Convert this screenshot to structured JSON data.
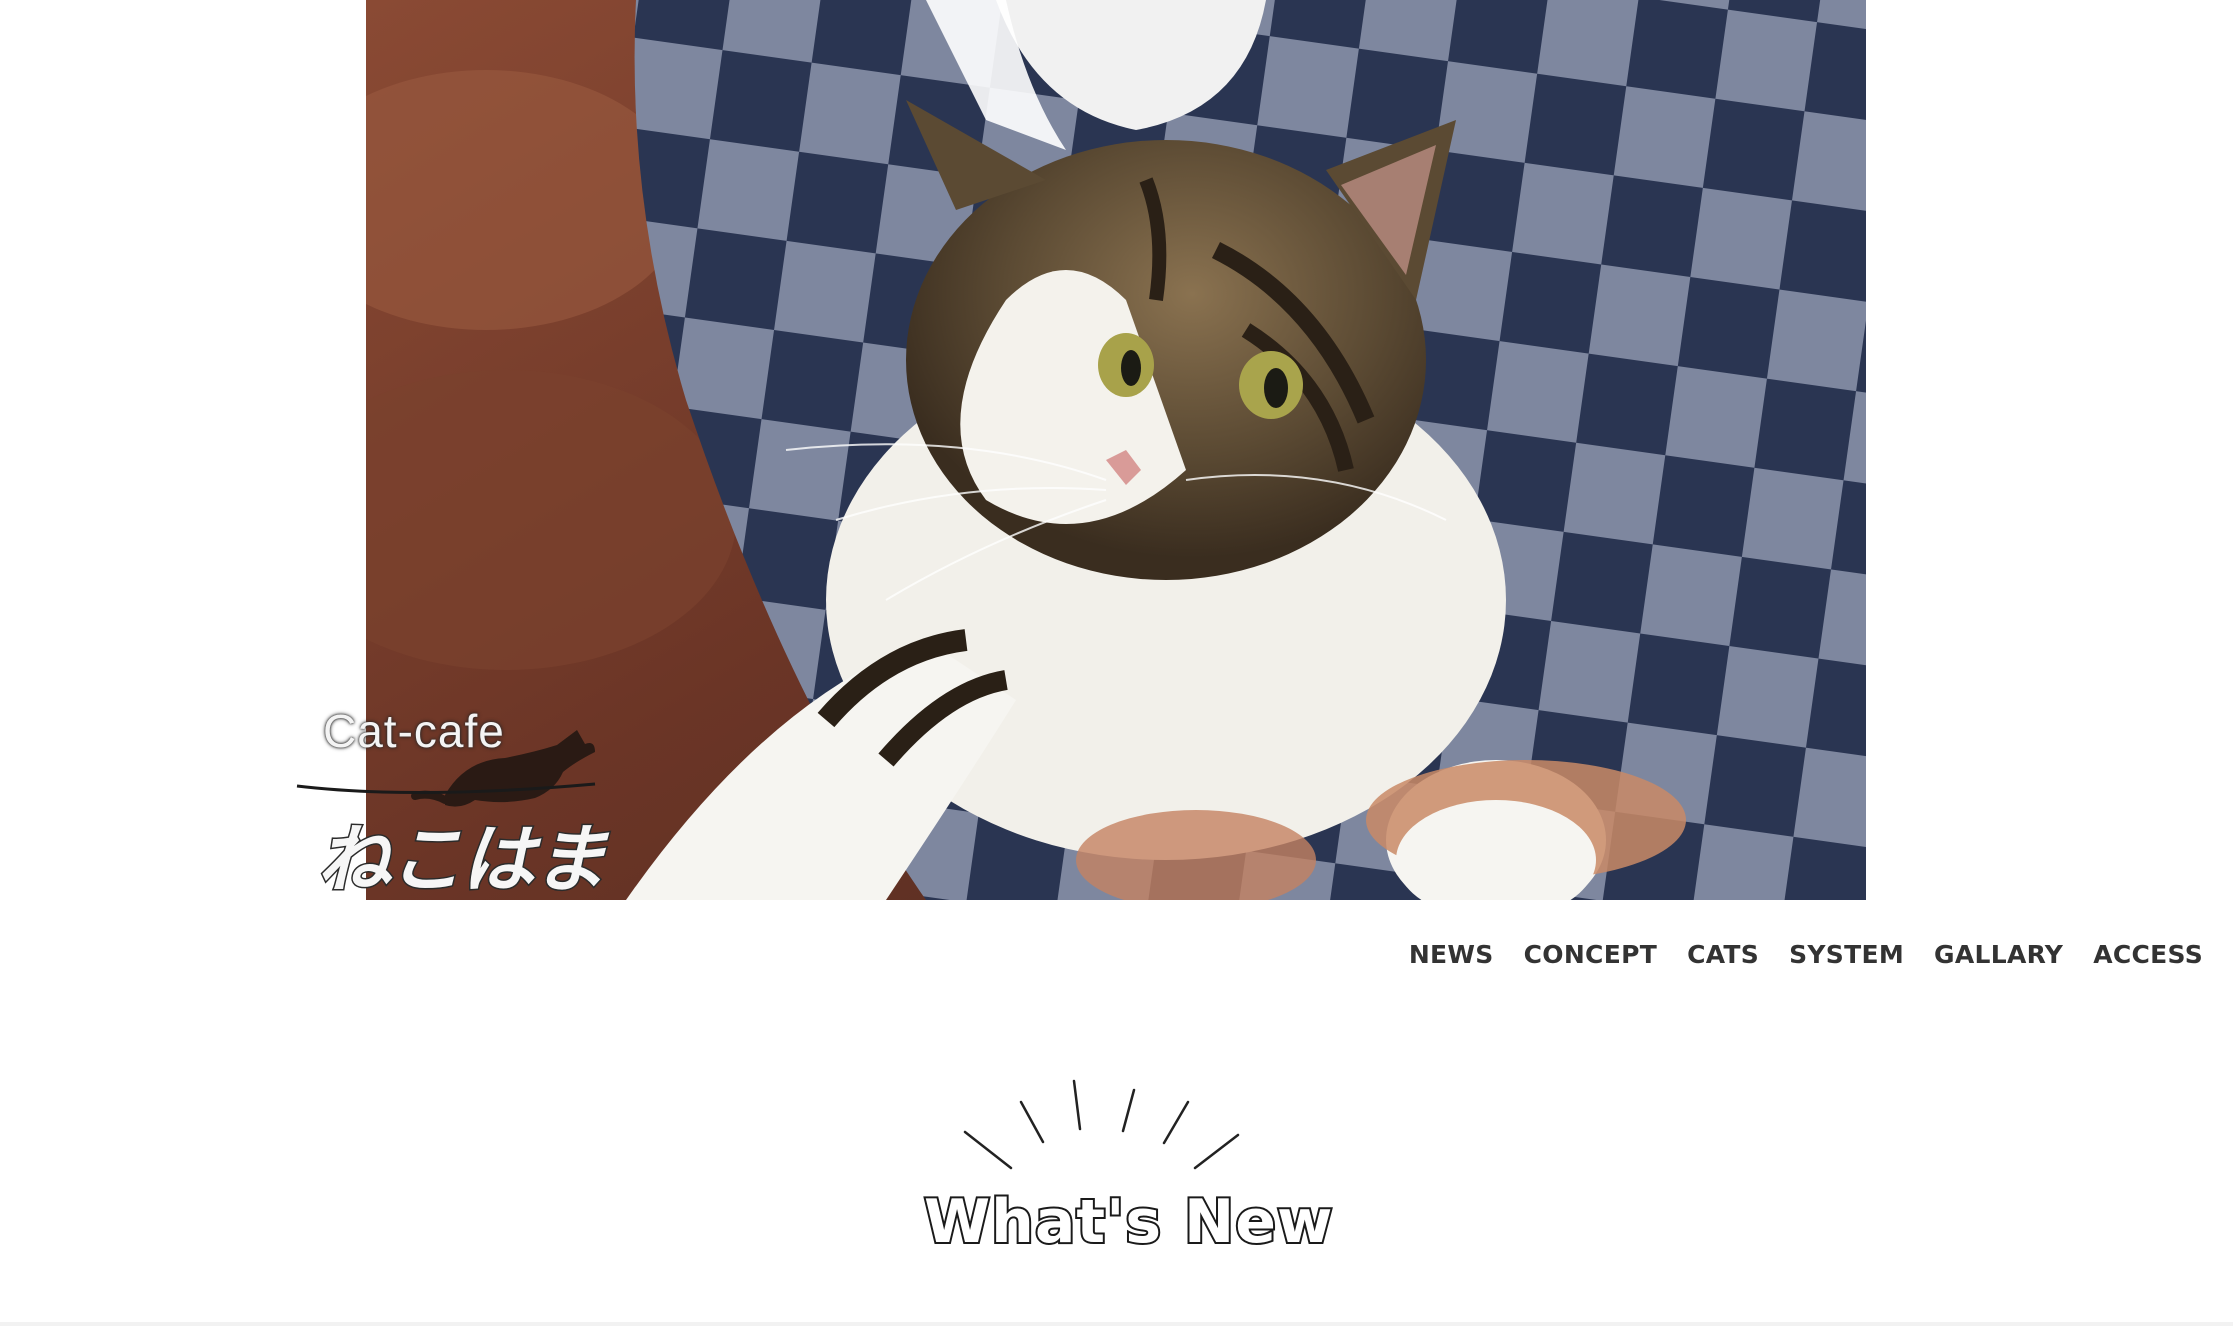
{
  "hero": {
    "image_name": "cat-photo"
  },
  "logo": {
    "english": "Cat-cafe",
    "japanese": "ねこはま"
  },
  "nav": {
    "items": [
      {
        "label": "NEWS"
      },
      {
        "label": "CONCEPT"
      },
      {
        "label": "CATS"
      },
      {
        "label": "SYSTEM"
      },
      {
        "label": "GALLARY"
      },
      {
        "label": "ACCESS"
      }
    ]
  },
  "section": {
    "title": "What's New"
  },
  "colors": {
    "nav_text": "#333333",
    "title_outline": "#1a1a1a",
    "background": "#ffffff"
  }
}
